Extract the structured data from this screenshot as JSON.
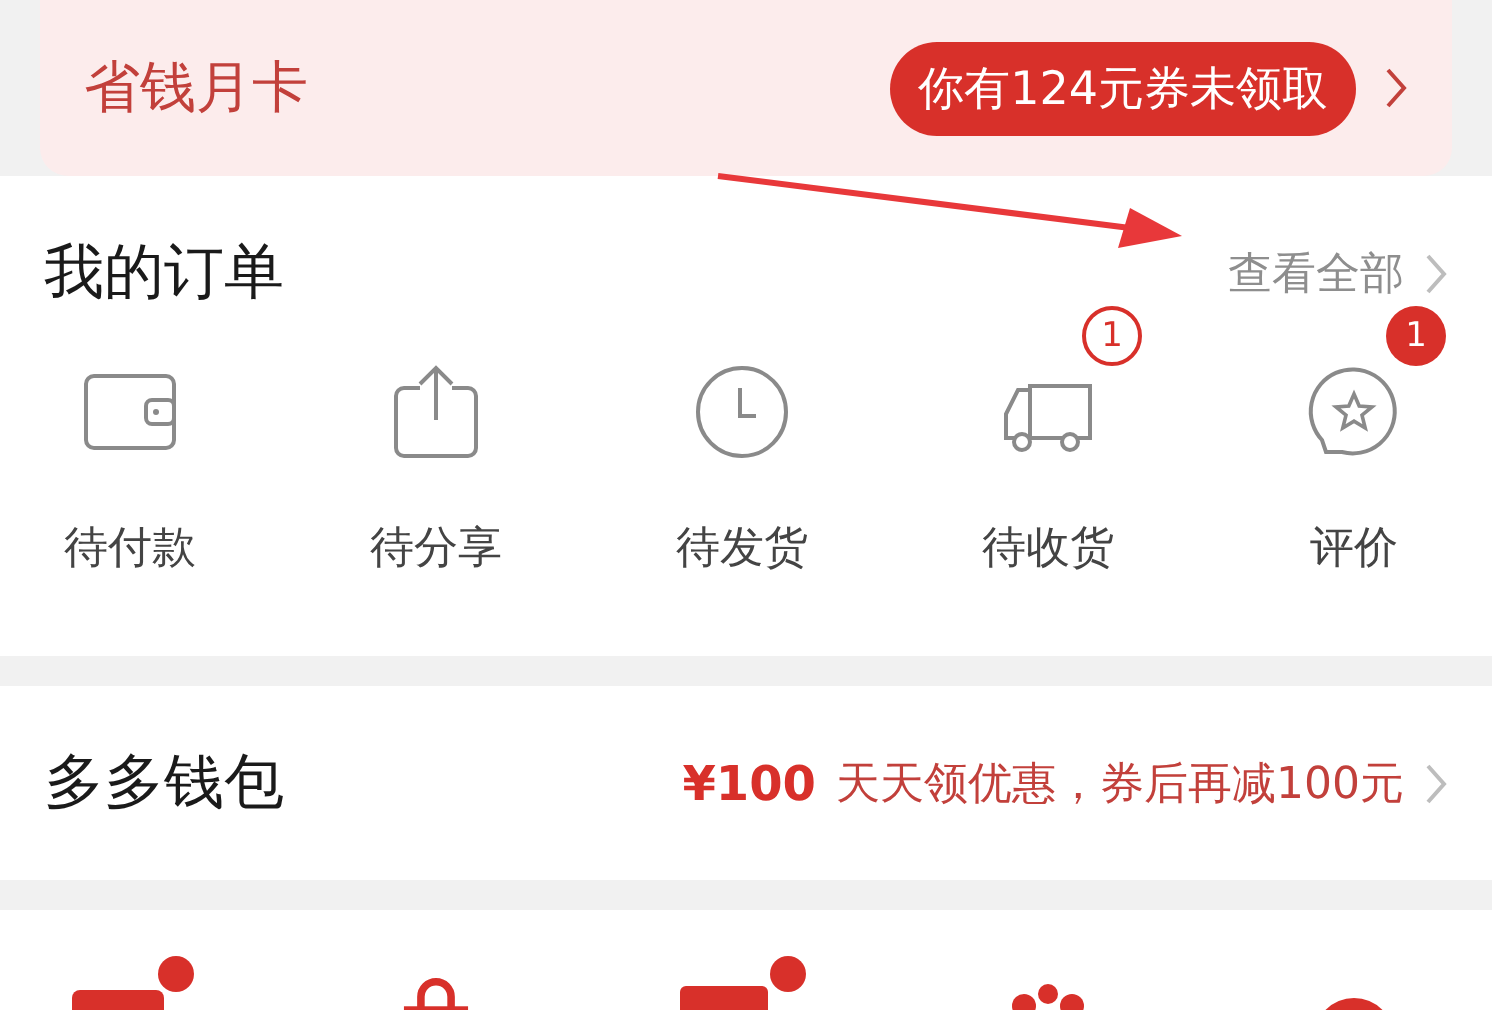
{
  "monthly_card": {
    "title": "省钱月卡",
    "coupon_pill": "你有124元券未领取"
  },
  "orders": {
    "title": "我的订单",
    "view_all": "查看全部",
    "items": [
      {
        "label": "待付款",
        "kind": "wallet"
      },
      {
        "label": "待分享",
        "kind": "share"
      },
      {
        "label": "待发货",
        "kind": "clock"
      },
      {
        "label": "待收货",
        "kind": "truck",
        "badge": {
          "text": "1",
          "kind": "outline"
        }
      },
      {
        "label": "评价",
        "kind": "review",
        "badge": {
          "text": "1",
          "kind": "filled"
        }
      }
    ]
  },
  "wallet": {
    "title": "多多钱包",
    "amount": "¥100",
    "promo": "天天领优惠，券后再减100元"
  }
}
